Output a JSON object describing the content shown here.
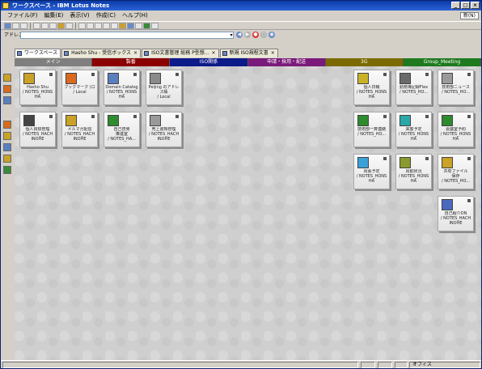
{
  "window": {
    "title": "ワークスペース - IBM Lotus Notes",
    "controls": [
      "_",
      "□",
      "×"
    ]
  },
  "menu": {
    "items": [
      "ファイル(F)",
      "編集(E)",
      "表示(V)",
      "作成(C)",
      "ヘルプ(H)"
    ],
    "tag": "新(N)"
  },
  "address": {
    "label": "アドレス",
    "value": "",
    "dropdown": "▾",
    "nav": [
      "◀",
      "▶",
      "●",
      "○",
      "◉"
    ]
  },
  "window_tabs": [
    {
      "label": "ワークスペース",
      "active": true
    },
    {
      "label": "Hasho Shu - 受信ボックス",
      "active": false
    },
    {
      "label": "ISO文書管理 総務 P型想...",
      "active": false
    },
    {
      "label": "新規 ISO規程文書",
      "active": false
    }
  ],
  "page_tabs": [
    {
      "label": "メイン",
      "color": "#7f7f7f"
    },
    {
      "label": "製番",
      "color": "#8b0000"
    },
    {
      "label": "ISO関係",
      "color": "#0d1a8a"
    },
    {
      "label": "申請・採用・配送",
      "color": "#7a1a7a"
    },
    {
      "label": "3G",
      "color": "#7a6a00"
    },
    {
      "label": "Group_Meeting",
      "color": "#1f7a1f"
    }
  ],
  "tiles": [
    {
      "label": "Hasho Shu\n/ NOTES_HONS HA",
      "icon": "mail-icon",
      "color": "#c9a227"
    },
    {
      "label": "ブックマーク (ロ\n/ Local",
      "icon": "bookmark-icon",
      "color": "#d96a1e"
    },
    {
      "label": "Domain Catalog\n/ NOTES_HONS HA",
      "icon": "catalog-icon",
      "color": "#5a7fbf"
    },
    {
      "label": "Peijing のアドレス帳\n/ Local",
      "icon": "addressbook-icon",
      "color": "#8a8a8a"
    },
    {
      "label": "個人目標管理\n/ NOTES_HACH INOHE",
      "icon": "goal-icon",
      "color": "#444444"
    },
    {
      "label": "メルマガ配信\n/ NOTES_HACH INOHE",
      "icon": "newsletter-icon",
      "color": "#c9a227"
    },
    {
      "label": "自己啓発\n推進室\n/ NOTES_HA...",
      "icon": "selfdev-icon",
      "color": "#2e8b2e"
    },
    {
      "label": "売上書類管理\n/ NOTES_HACH INOHE",
      "icon": "sales-icon",
      "color": "#9a9a9a"
    },
    {
      "label": "個人日報\n/ NOTES_HONS HA",
      "icon": "diary-icon",
      "color": "#c9b227"
    },
    {
      "label": "勤務簿記録Flex\n/ NOTES_HO...",
      "icon": "attendance-icon",
      "color": "#6a6a6a"
    },
    {
      "label": "技術部ニュース\n/ NOTES_HO...",
      "icon": "news-icon",
      "color": "#9a9a9a"
    },
    {
      "label": "技術部一斉連絡\n/ NOTES_HO...",
      "icon": "notice-icon",
      "color": "#2e8b2e"
    },
    {
      "label": "来客予定\n/ NOTES_HONS HA",
      "icon": "visitor-icon",
      "color": "#2aa8a8"
    },
    {
      "label": "会議室予約\n/ NOTES_HONS HA",
      "icon": "clock-icon",
      "color": "#2e8b2e"
    },
    {
      "label": "出張予定\n/ NOTES_HONS HA",
      "icon": "trip-icon",
      "color": "#3aa0d8"
    },
    {
      "label": "出勤状況\n/ NOTES_HONS HA",
      "icon": "presence-icon",
      "color": "#8a9a2e"
    },
    {
      "label": "共有ファイル\n保存\n/ NOTES_HO...",
      "icon": "shared-file-icon",
      "color": "#c9a227"
    },
    {
      "label": "自己紹介ON\n/ NOTES_HACH INOHE",
      "icon": "profile-icon",
      "color": "#4a6abf"
    }
  ],
  "status": {
    "office": "オフィス"
  }
}
